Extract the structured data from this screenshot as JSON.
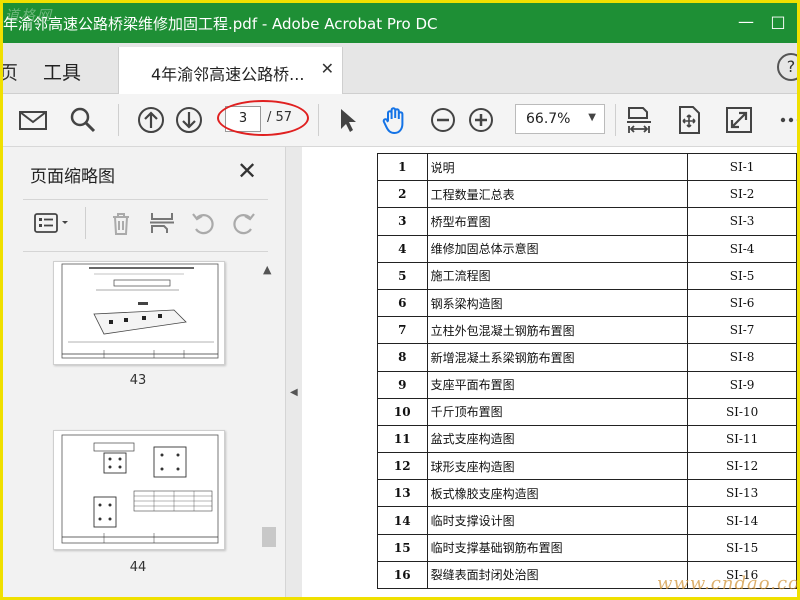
{
  "window": {
    "title": "年渝邻高速公路桥梁维修加固工程.pdf - Adobe Acrobat Pro DC",
    "watermark_logo": "道格网"
  },
  "tabs": {
    "home_label": "页",
    "tools_label": "工具",
    "document_tab_label": "4年渝邻高速公路桥...",
    "help_label": "?"
  },
  "toolbar": {
    "current_page": "3",
    "total_pages": "/ 57",
    "zoom_level": "66.7%"
  },
  "thumbnails_panel": {
    "title": "页面缩略图",
    "thumbnails": [
      {
        "page": "43"
      },
      {
        "page": "44"
      }
    ]
  },
  "document": {
    "rows": [
      {
        "num": "1",
        "name": "说明",
        "code": "SI-1"
      },
      {
        "num": "2",
        "name": "工程数量汇总表",
        "code": "SI-2"
      },
      {
        "num": "3",
        "name": "桥型布置图",
        "code": "SI-3"
      },
      {
        "num": "4",
        "name": "维修加固总体示意图",
        "code": "SI-4"
      },
      {
        "num": "5",
        "name": "施工流程图",
        "code": "SI-5"
      },
      {
        "num": "6",
        "name": "钢系梁构造图",
        "code": "SI-6"
      },
      {
        "num": "7",
        "name": "立柱外包混凝土钢筋布置图",
        "code": "SI-7"
      },
      {
        "num": "8",
        "name": "新增混凝土系梁钢筋布置图",
        "code": "SI-8"
      },
      {
        "num": "9",
        "name": "支座平面布置图",
        "code": "SI-9"
      },
      {
        "num": "10",
        "name": "千斤顶布置图",
        "code": "SI-10"
      },
      {
        "num": "11",
        "name": "盆式支座构造图",
        "code": "SI-11"
      },
      {
        "num": "12",
        "name": "球形支座构造图",
        "code": "SI-12"
      },
      {
        "num": "13",
        "name": "板式橡胶支座构造图",
        "code": "SI-13"
      },
      {
        "num": "14",
        "name": "临时支撑设计图",
        "code": "SI-14"
      },
      {
        "num": "15",
        "name": "临时支撑基础钢筋布置图",
        "code": "SI-15"
      },
      {
        "num": "16",
        "name": "裂缝表面封闭处治图",
        "code": "SI-16"
      }
    ],
    "watermark": "www.cndao.com"
  },
  "colors": {
    "titlebar": "#1e8f35",
    "frame_border": "#f0e000",
    "highlight_oval": "#e02020",
    "hand_tool": "#1473e6"
  }
}
